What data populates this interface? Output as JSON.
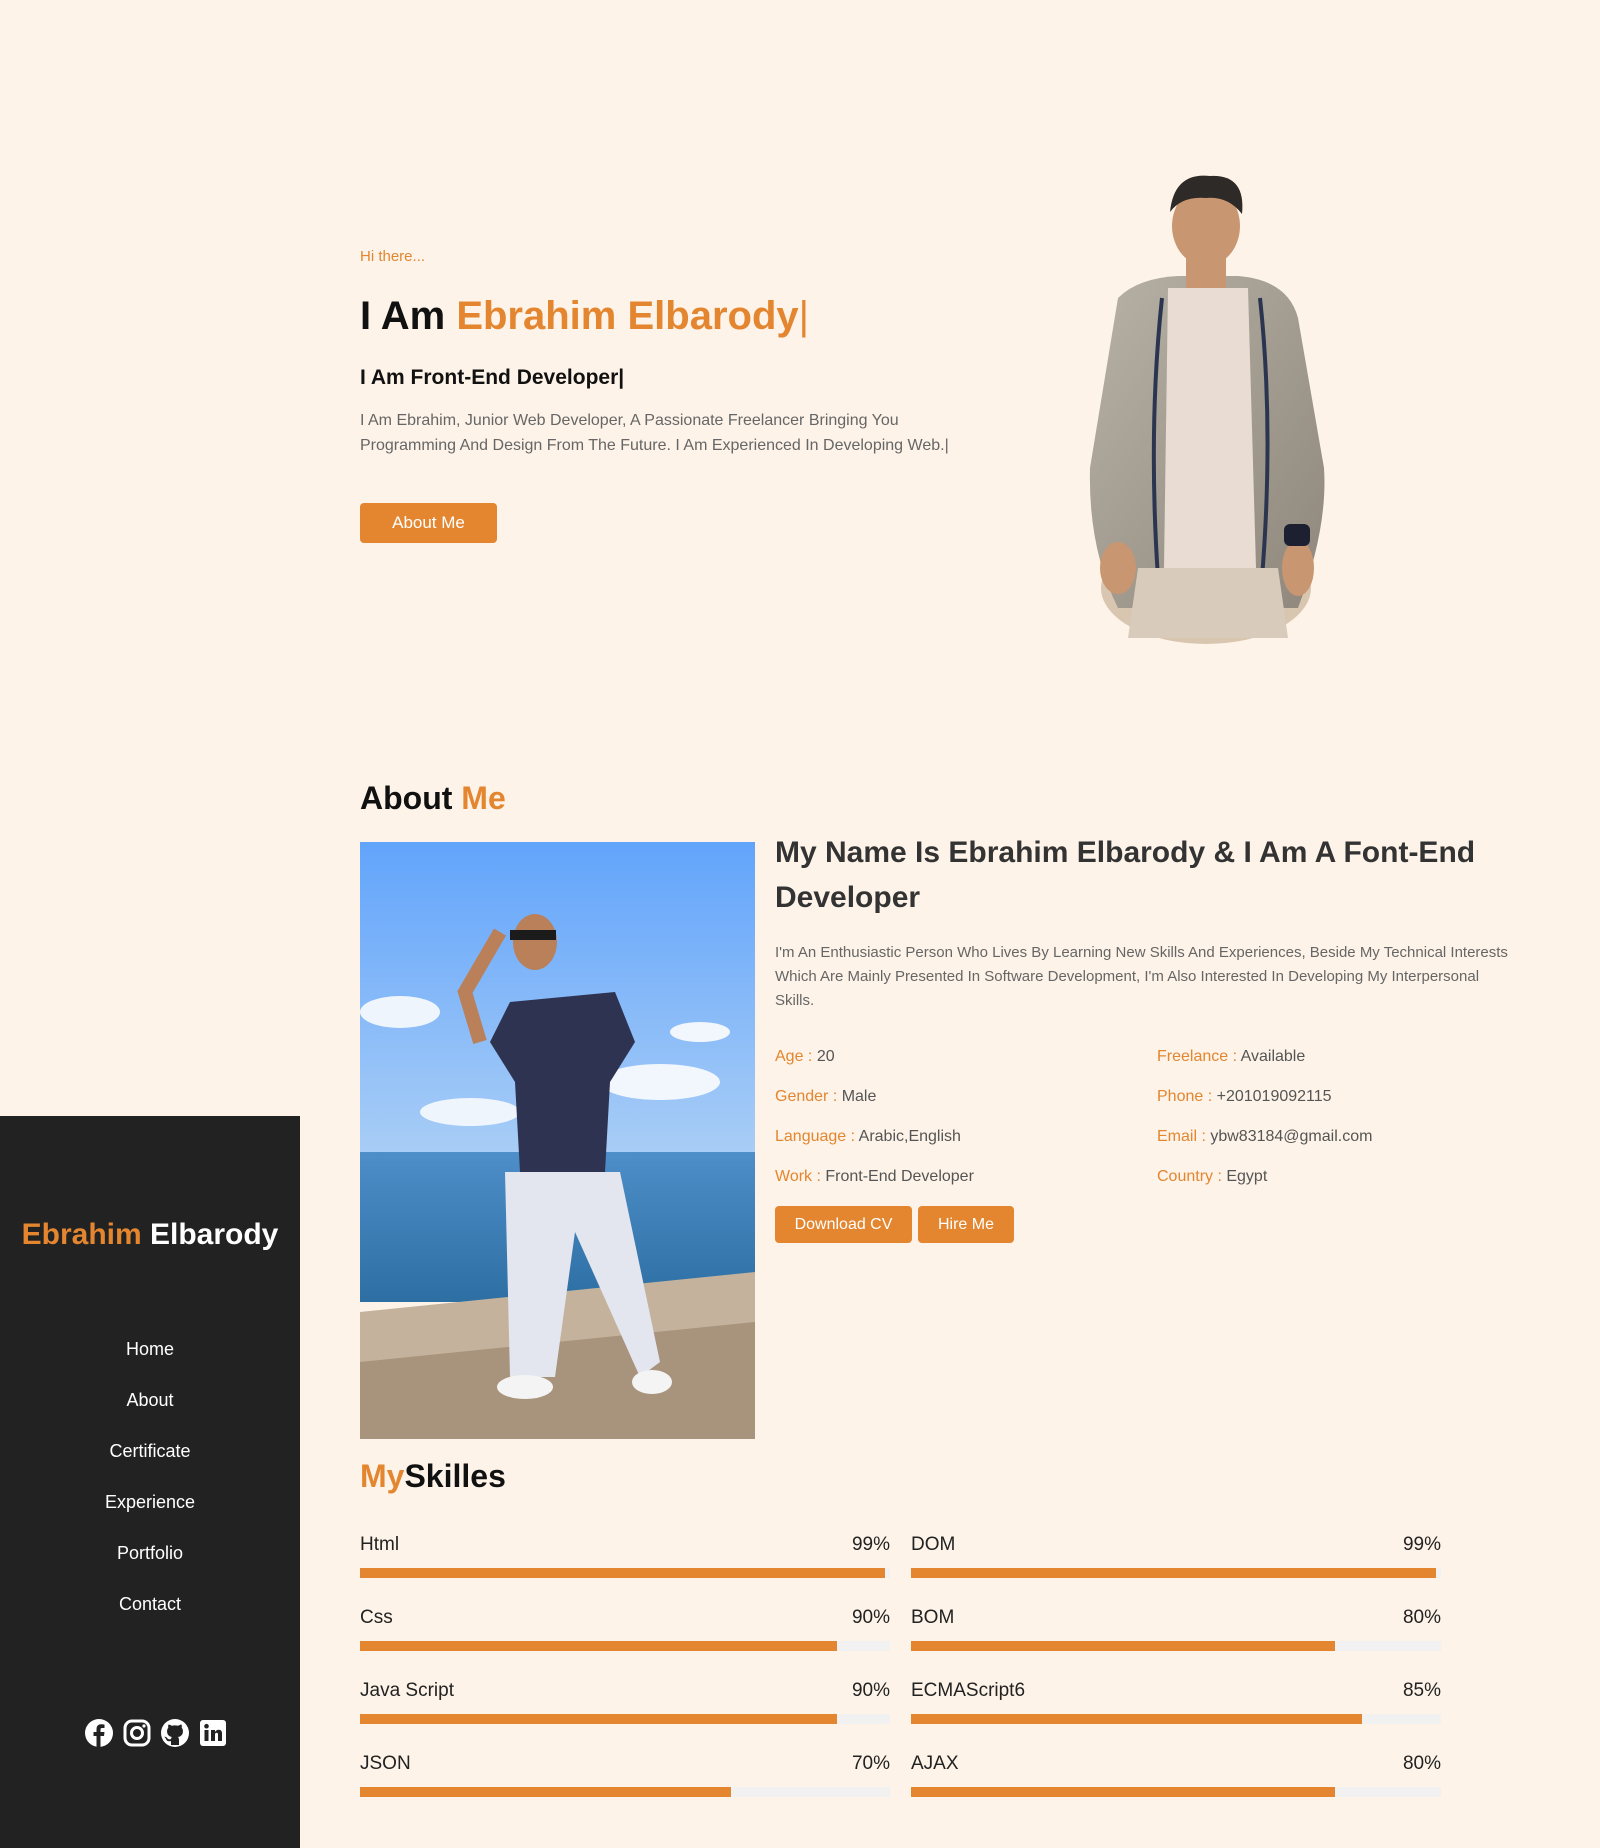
{
  "hero": {
    "greeting": "Hi there...",
    "title_prefix": "I Am ",
    "title_name": "Ebrahim Elbarody",
    "cursor": "|",
    "subtitle": "I Am Front-End Developer|",
    "description": "I Am Ebrahim, Junior Web Developer, A Passionate Freelancer Bringing You Programming And Design From The Future. I Am Experienced In Developing Web.|",
    "button": "About Me"
  },
  "about": {
    "title_a": "About ",
    "title_b": "Me",
    "heading": "My Name Is Ebrahim Elbarody & I Am A Font-End Developer",
    "text": "I'm An Enthusiastic Person Who Lives By Learning New Skills And Experiences, Beside My Technical Interests Which Are Mainly Presented In Software Development, I'm Also Interested In Developing My Interpersonal Skills.",
    "info": [
      {
        "key": "Age : ",
        "value": "20"
      },
      {
        "key": "Freelance : ",
        "value": "Available"
      },
      {
        "key": "Gender : ",
        "value": "Male"
      },
      {
        "key": "Phone : ",
        "value": "+201019092115"
      },
      {
        "key": "Language : ",
        "value": "Arabic,English"
      },
      {
        "key": "Email : ",
        "value": "ybw83184@gmail.com"
      },
      {
        "key": "Work : ",
        "value": "Front-End Developer"
      },
      {
        "key": "Country : ",
        "value": "Egypt"
      }
    ],
    "download_btn": "Download CV",
    "hire_btn": "Hire Me"
  },
  "skills": {
    "title_a": "My",
    "title_b": "Skilles",
    "items": [
      {
        "name": "Html",
        "percent": "99%",
        "level": 0.99
      },
      {
        "name": "DOM",
        "percent": "99%",
        "level": 0.99
      },
      {
        "name": "Css",
        "percent": "90%",
        "level": 0.9
      },
      {
        "name": "BOM",
        "percent": "80%",
        "level": 0.8
      },
      {
        "name": "Java Script",
        "percent": "90%",
        "level": 0.9
      },
      {
        "name": "ECMAScript6",
        "percent": "85%",
        "level": 0.85
      },
      {
        "name": "JSON",
        "percent": "70%",
        "level": 0.7
      },
      {
        "name": "AJAX",
        "percent": "80%",
        "level": 0.8
      }
    ]
  },
  "sidebar": {
    "brand_first": "Ebrahim",
    "brand_last": "Elbarody",
    "nav": [
      "Home",
      "About",
      "Certificate",
      "Experience",
      "Portfolio",
      "Contact"
    ],
    "social_icons": [
      "facebook-icon",
      "instagram-icon",
      "github-icon",
      "linkedin-icon"
    ]
  },
  "colors": {
    "accent": "#e3862f",
    "background": "#fdf3e8",
    "sidebar": "#222222"
  }
}
